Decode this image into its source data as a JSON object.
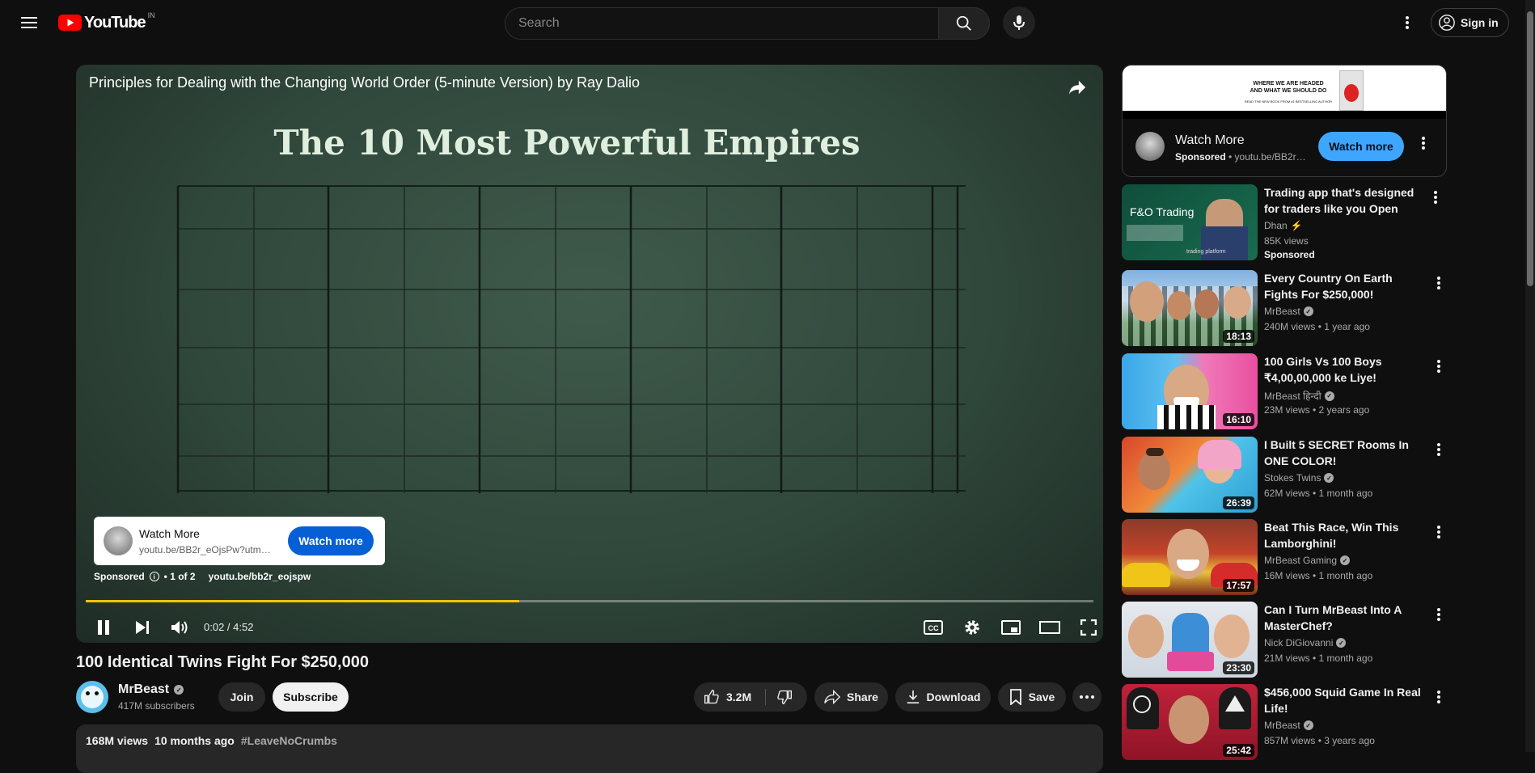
{
  "header": {
    "logo_text": "YouTube",
    "country_code": "IN",
    "search_placeholder": "Search",
    "sign_in_label": "Sign in"
  },
  "player": {
    "overlay_title": "Principles for Dealing with the Changing World Order (5-minute Version) by Ray Dalio",
    "slide_heading": "The 10 Most Powerful Empires",
    "ad": {
      "title": "Watch More",
      "url": "youtu.be/BB2r_eOjsPw?utm_source=ads",
      "button": "Watch more",
      "sponsored": "Sponsored",
      "ad_count": "• 1 of 2",
      "link": "youtu.be/bb2r_eojspw"
    },
    "progress": 0.43,
    "time": "0:02 / 4:52",
    "colors": {
      "progress": "#f5c400",
      "ad_button": "#065fd4"
    }
  },
  "video": {
    "title": "100 Identical Twins Fight For $250,000",
    "channel": "MrBeast",
    "subscribers": "417M subscribers",
    "join": "Join",
    "subscribe": "Subscribe",
    "likes": "3.2M",
    "share": "Share",
    "download": "Download",
    "save": "Save",
    "views": "168M views",
    "age": "10 months ago",
    "hashtag": "#LeaveNoCrumbs"
  },
  "sidebar": {
    "ad_panel": {
      "banner_line1": "WHERE WE ARE HEADED",
      "banner_line2": "AND WHAT WE SHOULD DO",
      "banner_line3": "READ THE NEW BOOK FROM #1 BESTSELLING AUTHOR",
      "title": "Watch More",
      "sponsored": "Sponsored",
      "url": "youtu.be/BB2r_eOjsPw",
      "button": "Watch more"
    },
    "recommendations": [
      {
        "title": "Trading app that's designed for traders like you Open account in minutes",
        "channel": "Dhan",
        "meta": "85K views",
        "sponsored": "Sponsored",
        "thumb_text": "F&O Trading",
        "thumb_sub": "trading platform"
      },
      {
        "title": "Every Country On Earth Fights For $250,000!",
        "channel": "MrBeast",
        "meta": "240M views • 1 year ago",
        "duration": "18:13"
      },
      {
        "title": "100 Girls Vs 100 Boys ₹4,00,00,000 ke Liye!",
        "channel": "MrBeast हिन्दी",
        "meta": "23M views • 2 years ago",
        "duration": "16:10"
      },
      {
        "title": "I Built 5 SECRET Rooms In ONE COLOR!",
        "channel": "Stokes Twins",
        "meta": "62M views • 1 month ago",
        "duration": "26:39"
      },
      {
        "title": "Beat This Race, Win This Lamborghini!",
        "channel": "MrBeast Gaming",
        "meta": "16M views • 1 month ago",
        "duration": "17:57"
      },
      {
        "title": "Can I Turn MrBeast Into A MasterChef?",
        "channel": "Nick DiGiovanni",
        "meta": "21M views • 1 month ago",
        "duration": "23:30"
      },
      {
        "title": "$456,000 Squid Game In Real Life!",
        "channel": "MrBeast",
        "meta": "857M views • 3 years ago",
        "duration": "25:42"
      }
    ]
  },
  "icons": [
    "menu-icon",
    "youtube-logo-icon",
    "search-icon",
    "mic-icon",
    "more-vert-icon",
    "account-icon",
    "share-icon",
    "pause-icon",
    "next-icon",
    "volume-icon",
    "cc-icon",
    "settings-icon",
    "miniplayer-icon",
    "theater-icon",
    "fullscreen-icon",
    "like-icon",
    "dislike-icon",
    "download-icon",
    "save-icon",
    "verified-icon"
  ]
}
